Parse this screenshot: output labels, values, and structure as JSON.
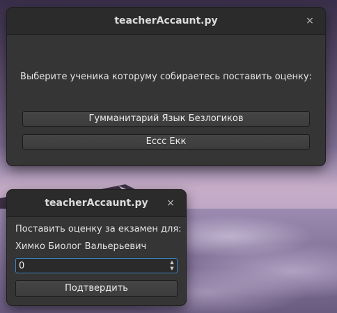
{
  "window_main": {
    "title": "teacherAccaunt.py",
    "close_glyph": "×",
    "prompt": "Выберите ученика которуму собираетесь поставить оценку:",
    "students": [
      "Гумманитарий Язык Безлогиков",
      "Ессс Екк"
    ]
  },
  "window_grade": {
    "title": "teacherAccaunt.py",
    "close_glyph": "×",
    "label": "Поставить оценку за екзамен для:",
    "student_name": "Химко Биолог Вальерьевич",
    "grade_value": "0",
    "spin_up": "▲",
    "spin_down": "▼",
    "confirm_label": "Подтвердить"
  }
}
